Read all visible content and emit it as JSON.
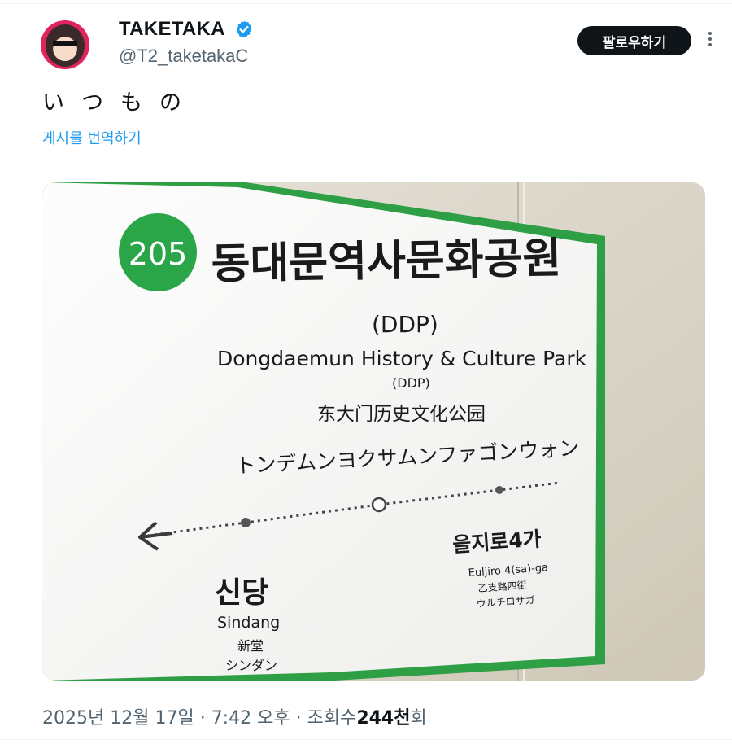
{
  "author": {
    "display_name": "TAKETAKA",
    "handle": "@T2_taketakaC",
    "verified": true,
    "follow_label": "팔로우하기"
  },
  "post": {
    "text": "いつもの",
    "translate_label": "게시물 번역하기"
  },
  "sign": {
    "station_number": "205",
    "station_name_ko": "동대문역사문화공원",
    "station_suffix": "(DDP)",
    "station_name_en": "Dongdaemun History & Culture Park",
    "station_suffix_en": "(DDP)",
    "station_name_zh": "东大门历史文化公园",
    "station_name_ja": "トンデムンヨクサムンファゴンウォン",
    "left_station": {
      "ko": "신당",
      "en": "Sindang",
      "zh": "新堂",
      "ja": "シンダン"
    },
    "right_station": {
      "ko": "을지로4가",
      "en": "Euljiro 4(sa)-ga",
      "zh": "乙支路四街",
      "ja": "ウルチロサガ"
    },
    "colors": {
      "line_green": "#2aa548",
      "frame_green": "#2f9f45",
      "wall": "#d9d4c7"
    }
  },
  "meta": {
    "date": "2025년 12월 17일",
    "time": "7:42 오후",
    "views_prefix": "조회수",
    "views_value": "244천",
    "views_suffix": "회",
    "separator": "·"
  },
  "icons": {
    "verified": "verified-badge-icon",
    "more": "more-dots-icon",
    "direction": "left-arrow-icon"
  }
}
